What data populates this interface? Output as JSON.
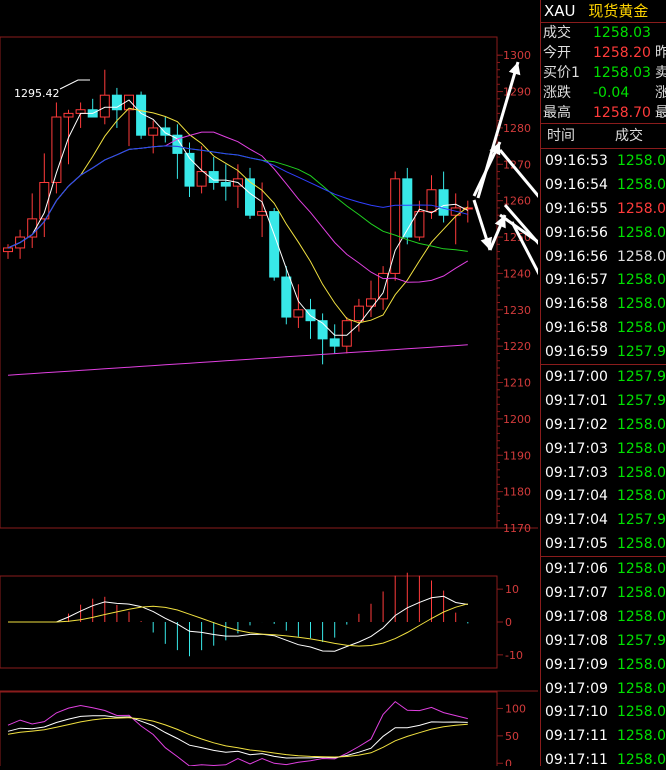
{
  "symbol": {
    "code": "XAU",
    "name": "现货黄金"
  },
  "quote": [
    {
      "label": "成交",
      "value": "1258.03",
      "color": "green",
      "extra": ""
    },
    {
      "label": "今开",
      "value": "1258.20",
      "color": "red",
      "extra": "昨"
    },
    {
      "label": "买价1",
      "value": "1258.03",
      "color": "green",
      "extra": "卖"
    },
    {
      "label": "涨跌",
      "value": "-0.04",
      "color": "green",
      "extra": "涨"
    },
    {
      "label": "最高",
      "value": "1258.70",
      "color": "red",
      "extra": "最"
    }
  ],
  "ticks_header": {
    "time": "时间",
    "price": "成交"
  },
  "ticks": [
    {
      "time": "09:16:53",
      "price": "1258.0",
      "color": "green"
    },
    {
      "time": "09:16:54",
      "price": "1258.0",
      "color": "green"
    },
    {
      "time": "09:16:55",
      "price": "1258.0",
      "color": "red"
    },
    {
      "time": "09:16:56",
      "price": "1258.0",
      "color": "green"
    },
    {
      "time": "09:16:56",
      "price": "1258.0",
      "color": "white"
    },
    {
      "time": "09:16:57",
      "price": "1258.0",
      "color": "green"
    },
    {
      "time": "09:16:58",
      "price": "1258.0",
      "color": "green"
    },
    {
      "time": "09:16:58",
      "price": "1258.0",
      "color": "green"
    },
    {
      "time": "09:16:59",
      "price": "1257.9",
      "color": "green",
      "sep": true
    },
    {
      "time": "09:17:00",
      "price": "1257.9",
      "color": "green"
    },
    {
      "time": "09:17:01",
      "price": "1257.9",
      "color": "green"
    },
    {
      "time": "09:17:02",
      "price": "1258.0",
      "color": "green"
    },
    {
      "time": "09:17:03",
      "price": "1258.0",
      "color": "green"
    },
    {
      "time": "09:17:03",
      "price": "1258.0",
      "color": "green"
    },
    {
      "time": "09:17:04",
      "price": "1258.0",
      "color": "green"
    },
    {
      "time": "09:17:04",
      "price": "1257.9",
      "color": "green"
    },
    {
      "time": "09:17:05",
      "price": "1258.0",
      "color": "green",
      "sep": true
    },
    {
      "time": "09:17:06",
      "price": "1258.0",
      "color": "green"
    },
    {
      "time": "09:17:07",
      "price": "1258.0",
      "color": "green"
    },
    {
      "time": "09:17:08",
      "price": "1258.0",
      "color": "green"
    },
    {
      "time": "09:17:08",
      "price": "1257.9",
      "color": "green"
    },
    {
      "time": "09:17:09",
      "price": "1258.0",
      "color": "green"
    },
    {
      "time": "09:17:09",
      "price": "1258.0",
      "color": "green"
    },
    {
      "time": "09:17:10",
      "price": "1258.0",
      "color": "green"
    },
    {
      "time": "09:17:11",
      "price": "1258.0",
      "color": "green"
    },
    {
      "time": "09:17:11",
      "price": "1258.0",
      "color": "green"
    }
  ],
  "chart_data": [
    {
      "type": "candlestick",
      "annotation": "1295.42",
      "y_ticks": [
        1300,
        1290,
        1280,
        1270,
        1260,
        1250,
        1240,
        1230,
        1220,
        1210,
        1200,
        1190,
        1180,
        1170
      ],
      "ylim": [
        1170,
        1305
      ],
      "candles": [
        {
          "o": 1246,
          "h": 1248,
          "l": 1244,
          "c": 1247
        },
        {
          "o": 1247,
          "h": 1252,
          "l": 1244,
          "c": 1250
        },
        {
          "o": 1250,
          "h": 1262,
          "l": 1247,
          "c": 1255
        },
        {
          "o": 1255,
          "h": 1273,
          "l": 1250,
          "c": 1265
        },
        {
          "o": 1265,
          "h": 1287,
          "l": 1262,
          "c": 1283
        },
        {
          "o": 1283,
          "h": 1285,
          "l": 1270,
          "c": 1284
        },
        {
          "o": 1284,
          "h": 1287,
          "l": 1280,
          "c": 1285
        },
        {
          "o": 1285,
          "h": 1288,
          "l": 1283,
          "c": 1283
        },
        {
          "o": 1283,
          "h": 1296,
          "l": 1281,
          "c": 1289
        },
        {
          "o": 1289,
          "h": 1291,
          "l": 1280,
          "c": 1285
        },
        {
          "o": 1285,
          "h": 1289,
          "l": 1275,
          "c": 1289
        },
        {
          "o": 1289,
          "h": 1290,
          "l": 1277,
          "c": 1278
        },
        {
          "o": 1278,
          "h": 1282,
          "l": 1273,
          "c": 1280
        },
        {
          "o": 1280,
          "h": 1283,
          "l": 1276,
          "c": 1278
        },
        {
          "o": 1278,
          "h": 1281,
          "l": 1266,
          "c": 1273
        },
        {
          "o": 1273,
          "h": 1276,
          "l": 1261,
          "c": 1264
        },
        {
          "o": 1264,
          "h": 1275,
          "l": 1262,
          "c": 1268
        },
        {
          "o": 1268,
          "h": 1272,
          "l": 1263,
          "c": 1265
        },
        {
          "o": 1265,
          "h": 1270,
          "l": 1260,
          "c": 1264
        },
        {
          "o": 1264,
          "h": 1270,
          "l": 1258,
          "c": 1266
        },
        {
          "o": 1266,
          "h": 1269,
          "l": 1255,
          "c": 1256
        },
        {
          "o": 1256,
          "h": 1265,
          "l": 1250,
          "c": 1257
        },
        {
          "o": 1257,
          "h": 1258,
          "l": 1238,
          "c": 1239
        },
        {
          "o": 1239,
          "h": 1242,
          "l": 1226,
          "c": 1228
        },
        {
          "o": 1228,
          "h": 1237,
          "l": 1225,
          "c": 1230
        },
        {
          "o": 1230,
          "h": 1233,
          "l": 1222,
          "c": 1227
        },
        {
          "o": 1227,
          "h": 1229,
          "l": 1215,
          "c": 1222
        },
        {
          "o": 1222,
          "h": 1226,
          "l": 1218,
          "c": 1220
        },
        {
          "o": 1220,
          "h": 1228,
          "l": 1218,
          "c": 1227
        },
        {
          "o": 1227,
          "h": 1233,
          "l": 1224,
          "c": 1231
        },
        {
          "o": 1231,
          "h": 1238,
          "l": 1228,
          "c": 1233
        },
        {
          "o": 1233,
          "h": 1242,
          "l": 1230,
          "c": 1240
        },
        {
          "o": 1240,
          "h": 1268,
          "l": 1238,
          "c": 1266
        },
        {
          "o": 1266,
          "h": 1269,
          "l": 1248,
          "c": 1250
        },
        {
          "o": 1250,
          "h": 1260,
          "l": 1249,
          "c": 1257
        },
        {
          "o": 1257,
          "h": 1267,
          "l": 1255,
          "c": 1263
        },
        {
          "o": 1263,
          "h": 1268,
          "l": 1254,
          "c": 1256
        },
        {
          "o": 1256,
          "h": 1262,
          "l": 1248,
          "c": 1258
        },
        {
          "o": 1258,
          "h": 1260,
          "l": 1254,
          "c": 1258
        }
      ]
    },
    {
      "type": "bar",
      "name": "macd",
      "y_ticks": [
        10,
        0,
        -10
      ],
      "ylim": [
        -14,
        14
      ]
    },
    {
      "type": "line",
      "name": "kdj",
      "y_ticks": [
        100,
        50,
        0
      ],
      "ylim": [
        -5,
        130
      ]
    }
  ]
}
